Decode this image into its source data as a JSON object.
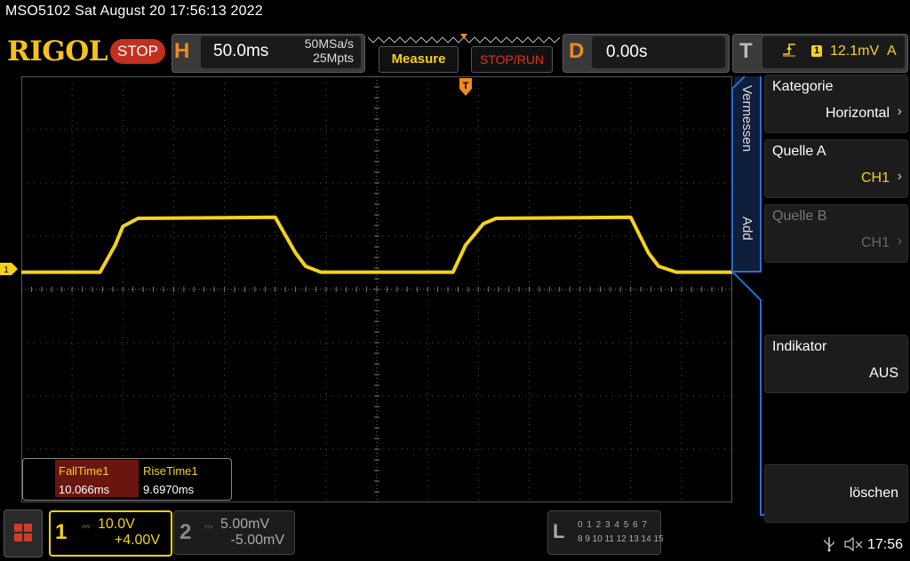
{
  "status_line": "MSO5102  Sat August 20 17:56:13 2022",
  "brand": "RIGOL",
  "run_state": "STOP",
  "horizontal": {
    "letter": "H",
    "timebase": "50.0ms",
    "sample_rate": "50MSa/s",
    "mem_depth": "25Mpts"
  },
  "buttons": {
    "measure": "Measure",
    "stop_run": "STOP/RUN"
  },
  "delay": {
    "letter": "D",
    "value": "0.00s"
  },
  "trigger": {
    "letter": "T",
    "edge_icon": "rising-edge-icon",
    "source": "1",
    "level": "12.1mV",
    "mode": "A"
  },
  "ch1_marker": "1",
  "measurements": [
    {
      "name": "FallTime1",
      "value": "10.066ms"
    },
    {
      "name": "RiseTime1",
      "value": "9.6970ms"
    }
  ],
  "menu": {
    "tabs": [
      "Vermessen",
      "Add"
    ],
    "items": [
      {
        "title": "Kategorie",
        "value": "Horizontal",
        "enabled": true
      },
      {
        "title": "Quelle A",
        "value": "CH1",
        "enabled": true,
        "value_color": "#f4d21a"
      },
      {
        "title": "Quelle B",
        "value": "CH1",
        "enabled": false
      },
      {
        "title": "Indikator",
        "value": "AUS",
        "enabled": true
      },
      {
        "title": "",
        "value": "löschen",
        "enabled": true
      }
    ]
  },
  "channels": [
    {
      "num": "1",
      "scale": "10.0V",
      "offset": "+4.00V",
      "active": true,
      "color": "#f4d21a"
    },
    {
      "num": "2",
      "scale": "5.00mV",
      "offset": "-5.00mV",
      "active": false,
      "color": "#888888"
    }
  ],
  "logic": {
    "letter": "L",
    "row1": "0 1 2 3   4 5 6 7",
    "row2": "8  9 10 11  12 13 14 15"
  },
  "clock": "17:56",
  "colors": {
    "trace": "#f4d21a",
    "accent": "#f08a1c",
    "menu_border": "#2a6fd6"
  },
  "chart_data": {
    "type": "line",
    "title": "",
    "xlabel": "",
    "ylabel": "",
    "grid": true,
    "x_divisions": 14,
    "y_divisions": 8,
    "series": [
      {
        "name": "CH1",
        "x_div": [
          0,
          1.55,
          1.85,
          2.0,
          2.3,
          5.0,
          5.4,
          5.6,
          5.9,
          8.5,
          8.75,
          9.1,
          9.35,
          12.0,
          12.35,
          12.55,
          12.9,
          14.0
        ],
        "y_div": [
          -0.06,
          -0.06,
          0.45,
          0.8,
          0.95,
          0.97,
          0.3,
          0.05,
          -0.06,
          -0.06,
          0.45,
          0.85,
          0.95,
          0.97,
          0.3,
          0.05,
          -0.06,
          -0.06
        ]
      }
    ]
  }
}
